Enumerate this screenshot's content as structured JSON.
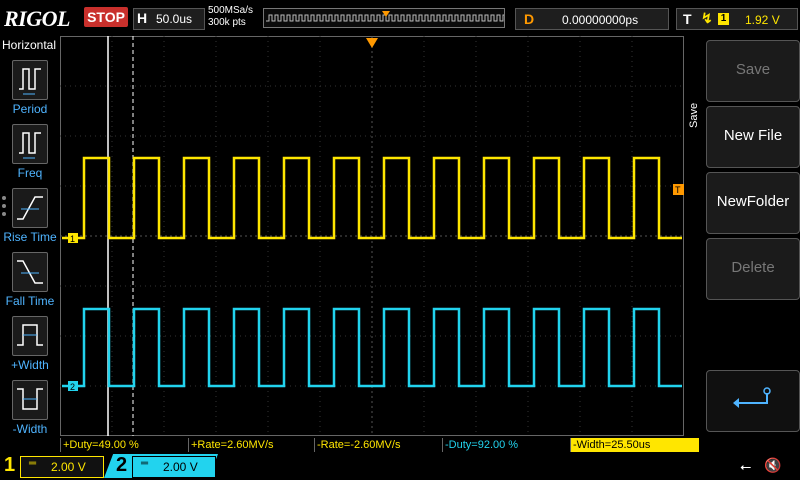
{
  "brand": "RIGOL",
  "run_state": "STOP",
  "horizontal": {
    "label": "H",
    "timebase": "50.0us",
    "sample_rate": "500MSa/s",
    "memory_depth": "300k pts"
  },
  "delay": {
    "label": "D",
    "value": "0.00000000ps"
  },
  "trigger": {
    "label": "T",
    "source": "1",
    "level": "1.92 V"
  },
  "left_menu": {
    "title": "Horizontal",
    "items": [
      {
        "label": "Period",
        "icon": "period-icon"
      },
      {
        "label": "Freq",
        "icon": "frequency-icon"
      },
      {
        "label": "Rise Time",
        "icon": "rise-time-icon"
      },
      {
        "label": "Fall Time",
        "icon": "fall-time-icon"
      },
      {
        "label": "+Width",
        "icon": "positive-width-icon"
      },
      {
        "label": "-Width",
        "icon": "negative-width-icon"
      }
    ]
  },
  "right_menu": {
    "title": "Save",
    "buttons": [
      {
        "label": "Save",
        "enabled": false
      },
      {
        "label": "New File",
        "enabled": true
      },
      {
        "label": "NewFolder",
        "enabled": true
      },
      {
        "label": "Delete",
        "enabled": false
      },
      {
        "label": "",
        "icon": "enter-return-icon",
        "enabled": true
      }
    ]
  },
  "markers": {
    "ch1": "1",
    "ch2": "2",
    "trigger_level": "T"
  },
  "measurements": [
    {
      "text": "+Duty=49.00 %",
      "channel": "ch1"
    },
    {
      "text": "+Rate=2.60MV/s",
      "channel": "ch1"
    },
    {
      "text": "-Rate=-2.60MV/s",
      "channel": "ch1"
    },
    {
      "text": "-Duty=92.00 %",
      "channel": "ch2"
    },
    {
      "text": "-Width=25.50us",
      "channel": "ch1",
      "highlight": true
    }
  ],
  "channels": [
    {
      "num": "1",
      "coupling": "═",
      "scale": "2.00 V",
      "color": "#ffe600"
    },
    {
      "num": "2",
      "coupling": "═",
      "scale": "2.00 V",
      "color": "#22d3ee"
    }
  ],
  "status_icons": {
    "usb": "usb-icon",
    "speaker": "speaker-muted-icon"
  },
  "colors": {
    "ch1": "#ffe600",
    "ch2": "#22d3ee",
    "accent": "#ff9900",
    "stop": "#c9302c",
    "menu_label": "#4fb4ff"
  }
}
